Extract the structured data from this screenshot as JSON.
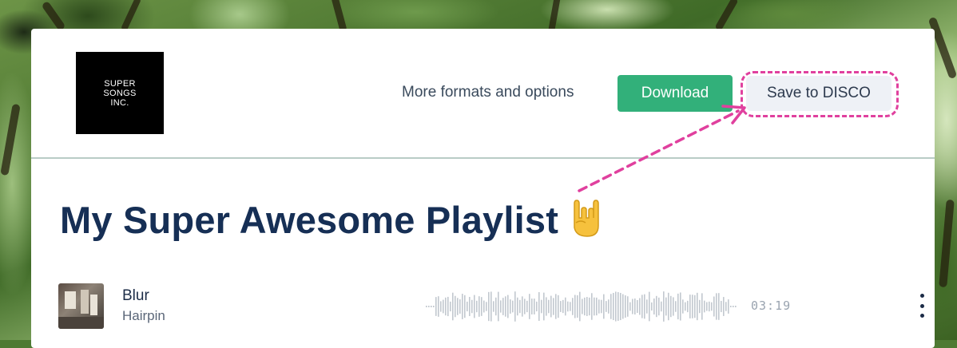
{
  "logo": {
    "lines": [
      "SUPER",
      "SONGS",
      "INC."
    ]
  },
  "header": {
    "more_link": "More formats and options",
    "download_label": "Download",
    "save_label": "Save to DISCO"
  },
  "playlist": {
    "title": "My Super Awesome Playlist"
  },
  "track": {
    "title": "Blur",
    "artist": "Hairpin",
    "duration": "03:19"
  },
  "icons": {
    "emoji": "sign-of-horns-icon",
    "menu": "more-vertical-icon",
    "arrow": "dashed-arrow-annotation"
  },
  "colors": {
    "accent": "#32b07a",
    "highlight": "#e0409e",
    "title": "#162f55"
  }
}
